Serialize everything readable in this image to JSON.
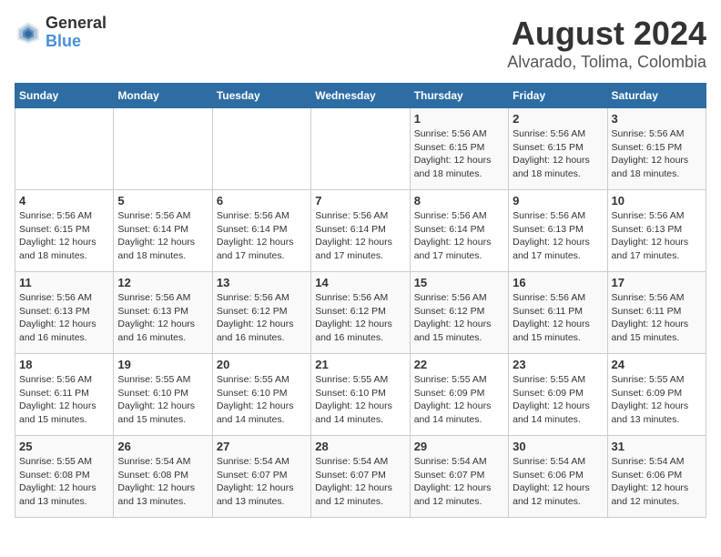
{
  "logo": {
    "line1": "General",
    "line2": "Blue"
  },
  "title": "August 2024",
  "subtitle": "Alvarado, Tolima, Colombia",
  "days_of_week": [
    "Sunday",
    "Monday",
    "Tuesday",
    "Wednesday",
    "Thursday",
    "Friday",
    "Saturday"
  ],
  "weeks": [
    [
      {
        "day": "",
        "info": ""
      },
      {
        "day": "",
        "info": ""
      },
      {
        "day": "",
        "info": ""
      },
      {
        "day": "",
        "info": ""
      },
      {
        "day": "1",
        "info": "Sunrise: 5:56 AM\nSunset: 6:15 PM\nDaylight: 12 hours\nand 18 minutes."
      },
      {
        "day": "2",
        "info": "Sunrise: 5:56 AM\nSunset: 6:15 PM\nDaylight: 12 hours\nand 18 minutes."
      },
      {
        "day": "3",
        "info": "Sunrise: 5:56 AM\nSunset: 6:15 PM\nDaylight: 12 hours\nand 18 minutes."
      }
    ],
    [
      {
        "day": "4",
        "info": "Sunrise: 5:56 AM\nSunset: 6:15 PM\nDaylight: 12 hours\nand 18 minutes."
      },
      {
        "day": "5",
        "info": "Sunrise: 5:56 AM\nSunset: 6:14 PM\nDaylight: 12 hours\nand 18 minutes."
      },
      {
        "day": "6",
        "info": "Sunrise: 5:56 AM\nSunset: 6:14 PM\nDaylight: 12 hours\nand 17 minutes."
      },
      {
        "day": "7",
        "info": "Sunrise: 5:56 AM\nSunset: 6:14 PM\nDaylight: 12 hours\nand 17 minutes."
      },
      {
        "day": "8",
        "info": "Sunrise: 5:56 AM\nSunset: 6:14 PM\nDaylight: 12 hours\nand 17 minutes."
      },
      {
        "day": "9",
        "info": "Sunrise: 5:56 AM\nSunset: 6:13 PM\nDaylight: 12 hours\nand 17 minutes."
      },
      {
        "day": "10",
        "info": "Sunrise: 5:56 AM\nSunset: 6:13 PM\nDaylight: 12 hours\nand 17 minutes."
      }
    ],
    [
      {
        "day": "11",
        "info": "Sunrise: 5:56 AM\nSunset: 6:13 PM\nDaylight: 12 hours\nand 16 minutes."
      },
      {
        "day": "12",
        "info": "Sunrise: 5:56 AM\nSunset: 6:13 PM\nDaylight: 12 hours\nand 16 minutes."
      },
      {
        "day": "13",
        "info": "Sunrise: 5:56 AM\nSunset: 6:12 PM\nDaylight: 12 hours\nand 16 minutes."
      },
      {
        "day": "14",
        "info": "Sunrise: 5:56 AM\nSunset: 6:12 PM\nDaylight: 12 hours\nand 16 minutes."
      },
      {
        "day": "15",
        "info": "Sunrise: 5:56 AM\nSunset: 6:12 PM\nDaylight: 12 hours\nand 15 minutes."
      },
      {
        "day": "16",
        "info": "Sunrise: 5:56 AM\nSunset: 6:11 PM\nDaylight: 12 hours\nand 15 minutes."
      },
      {
        "day": "17",
        "info": "Sunrise: 5:56 AM\nSunset: 6:11 PM\nDaylight: 12 hours\nand 15 minutes."
      }
    ],
    [
      {
        "day": "18",
        "info": "Sunrise: 5:56 AM\nSunset: 6:11 PM\nDaylight: 12 hours\nand 15 minutes."
      },
      {
        "day": "19",
        "info": "Sunrise: 5:55 AM\nSunset: 6:10 PM\nDaylight: 12 hours\nand 15 minutes."
      },
      {
        "day": "20",
        "info": "Sunrise: 5:55 AM\nSunset: 6:10 PM\nDaylight: 12 hours\nand 14 minutes."
      },
      {
        "day": "21",
        "info": "Sunrise: 5:55 AM\nSunset: 6:10 PM\nDaylight: 12 hours\nand 14 minutes."
      },
      {
        "day": "22",
        "info": "Sunrise: 5:55 AM\nSunset: 6:09 PM\nDaylight: 12 hours\nand 14 minutes."
      },
      {
        "day": "23",
        "info": "Sunrise: 5:55 AM\nSunset: 6:09 PM\nDaylight: 12 hours\nand 14 minutes."
      },
      {
        "day": "24",
        "info": "Sunrise: 5:55 AM\nSunset: 6:09 PM\nDaylight: 12 hours\nand 13 minutes."
      }
    ],
    [
      {
        "day": "25",
        "info": "Sunrise: 5:55 AM\nSunset: 6:08 PM\nDaylight: 12 hours\nand 13 minutes."
      },
      {
        "day": "26",
        "info": "Sunrise: 5:54 AM\nSunset: 6:08 PM\nDaylight: 12 hours\nand 13 minutes."
      },
      {
        "day": "27",
        "info": "Sunrise: 5:54 AM\nSunset: 6:07 PM\nDaylight: 12 hours\nand 13 minutes."
      },
      {
        "day": "28",
        "info": "Sunrise: 5:54 AM\nSunset: 6:07 PM\nDaylight: 12 hours\nand 12 minutes."
      },
      {
        "day": "29",
        "info": "Sunrise: 5:54 AM\nSunset: 6:07 PM\nDaylight: 12 hours\nand 12 minutes."
      },
      {
        "day": "30",
        "info": "Sunrise: 5:54 AM\nSunset: 6:06 PM\nDaylight: 12 hours\nand 12 minutes."
      },
      {
        "day": "31",
        "info": "Sunrise: 5:54 AM\nSunset: 6:06 PM\nDaylight: 12 hours\nand 12 minutes."
      }
    ]
  ]
}
